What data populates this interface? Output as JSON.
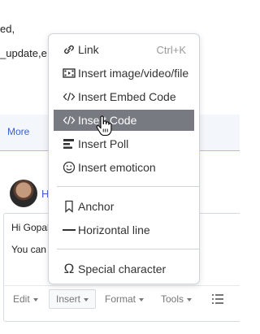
{
  "post": {
    "line1": "ed,",
    "line2": "_update,e"
  },
  "more_link": "More",
  "reply": {
    "author_initial": "H",
    "editor_line1": "Hi Gopal",
    "editor_line2": "You can"
  },
  "toolbar": {
    "edit": "Edit",
    "insert": "Insert",
    "format": "Format",
    "tools": "Tools"
  },
  "insert_menu": {
    "items": [
      {
        "label": "Link",
        "shortcut": "Ctrl+K",
        "icon": "link-icon"
      },
      {
        "label": "Insert image/video/file",
        "icon": "media-icon"
      },
      {
        "label": "Insert Embed Code",
        "icon": "embed-code-icon"
      },
      {
        "label": "Insert Code",
        "icon": "code-icon",
        "highlighted": true
      },
      {
        "label": "Insert Poll",
        "icon": "poll-icon"
      },
      {
        "label": "Insert emoticon",
        "icon": "emoticon-icon"
      },
      {
        "label": "Anchor",
        "icon": "bookmark-icon"
      },
      {
        "label": "Horizontal line",
        "icon": "horizontal-line-icon"
      },
      {
        "label": "Special character",
        "icon": "omega-icon"
      }
    ]
  },
  "colors": {
    "highlight": "#777a80",
    "link": "#3c5fd0",
    "more_bar_border": "#f0b84a"
  }
}
